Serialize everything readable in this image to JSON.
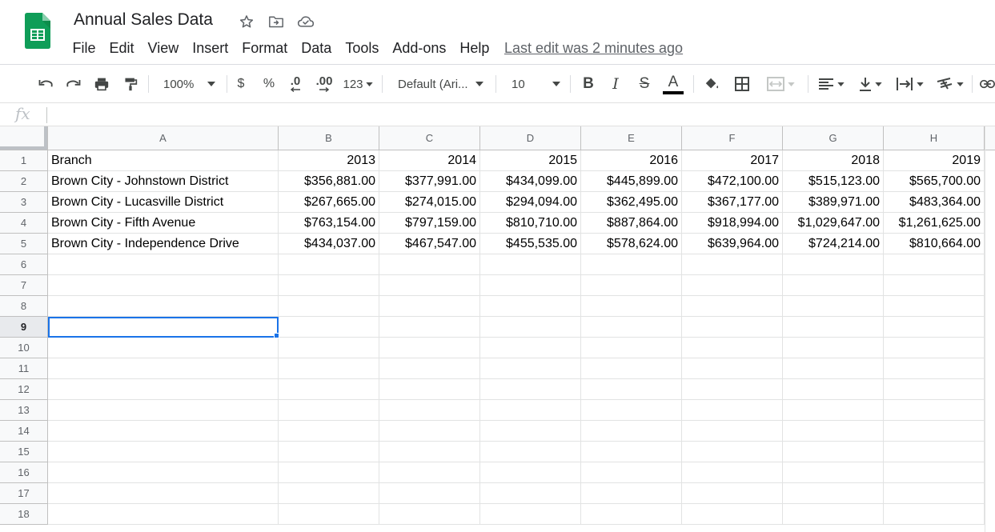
{
  "app": {
    "doc_title": "Annual Sales Data",
    "menu": [
      "File",
      "Edit",
      "View",
      "Insert",
      "Format",
      "Data",
      "Tools",
      "Add-ons",
      "Help"
    ],
    "last_edit": "Last edit was 2 minutes ago",
    "colors": {
      "accent": "#1a73e8",
      "sheets_green": "#0f9d58",
      "header_bg": "#f8f9fa",
      "grid_line": "#e2e3e3"
    },
    "title_icons": [
      "star-icon",
      "move-to-folder-icon",
      "cloud-saved-icon"
    ]
  },
  "toolbar": {
    "zoom": "100%",
    "currency": "$",
    "percent": "%",
    "decrease_decimal": ".0",
    "increase_decimal": ".00",
    "more_formats": "123",
    "font": "Default (Ari...",
    "font_size": "10",
    "bold": "B",
    "italic": "I",
    "strikethrough": "S",
    "text_color": "A",
    "text_color_value": "#000000"
  },
  "formula_bar": {
    "fx": "fx",
    "value": ""
  },
  "grid": {
    "columns": [
      "A",
      "B",
      "C",
      "D",
      "E",
      "F",
      "G",
      "H"
    ],
    "rows": [
      "1",
      "2",
      "3",
      "4",
      "5",
      "6",
      "7",
      "8",
      "9",
      "10",
      "11",
      "12",
      "13",
      "14",
      "15",
      "16",
      "17",
      "18"
    ],
    "active_row": "9",
    "active_cell": "A9",
    "data": [
      [
        "Branch",
        "2013",
        "2014",
        "2015",
        "2016",
        "2017",
        "2018",
        "2019"
      ],
      [
        "Brown City - Johnstown District",
        "$356,881.00",
        "$377,991.00",
        "$434,099.00",
        "$445,899.00",
        "$472,100.00",
        "$515,123.00",
        "$565,700.00"
      ],
      [
        "Brown City - Lucasville District",
        "$267,665.00",
        "$274,015.00",
        "$294,094.00",
        "$362,495.00",
        "$367,177.00",
        "$389,971.00",
        "$483,364.00"
      ],
      [
        "Brown City - Fifth Avenue",
        "$763,154.00",
        "$797,159.00",
        "$810,710.00",
        "$887,864.00",
        "$918,994.00",
        "$1,029,647.00",
        "$1,261,625.00"
      ],
      [
        "Brown City - Independence Drive",
        "$434,037.00",
        "$467,547.00",
        "$455,535.00",
        "$578,624.00",
        "$639,964.00",
        "$724,214.00",
        "$810,664.00"
      ]
    ]
  }
}
